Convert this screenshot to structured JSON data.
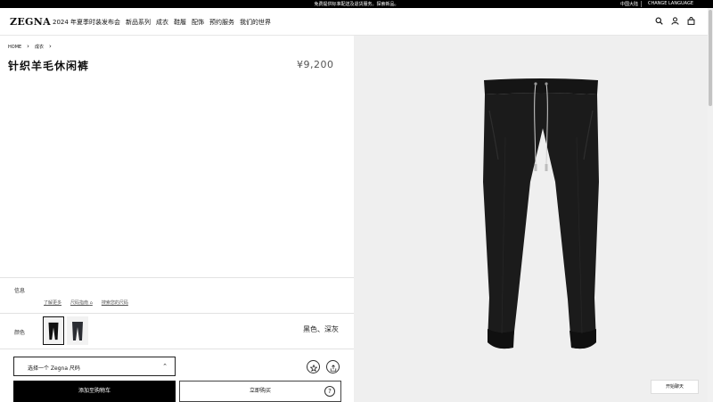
{
  "topbar": {
    "promo": "免费提供标准配送及退货服务。探索新品。",
    "region": "中国大陆",
    "language": "CHANGE LANGUAGE"
  },
  "header": {
    "logo": "ZEGNA",
    "nav": [
      "2024 年夏季时装发布会",
      "新品系列",
      "成衣",
      "鞋履",
      "配饰",
      "预约服务",
      "我们的世界"
    ],
    "icons": [
      "search-icon",
      "account-icon",
      "bag-icon"
    ]
  },
  "breadcrumb": {
    "items": [
      "HOME",
      "成衣"
    ]
  },
  "product": {
    "title": "针织羊毛休闲裤",
    "price": "¥9,200"
  },
  "info": {
    "label": "信息",
    "links": [
      "了解更多",
      "尺码指南",
      "搜索您的尺码"
    ]
  },
  "color": {
    "label": "颜色",
    "value": "黑色、深灰",
    "swatches": [
      {
        "name": "black",
        "hex": "#111111",
        "selected": true
      },
      {
        "name": "dark-grey",
        "hex": "#2b2d33",
        "selected": false
      }
    ]
  },
  "size": {
    "placeholder": "选择一个 Zegna 尺码"
  },
  "actions": {
    "add_to_cart": "添加至购物车",
    "buy_now": "立即购买",
    "help": "?"
  },
  "chat": {
    "label": "开始聊天"
  },
  "colors": {
    "accent": "#000000",
    "image_bg": "#efefef"
  }
}
